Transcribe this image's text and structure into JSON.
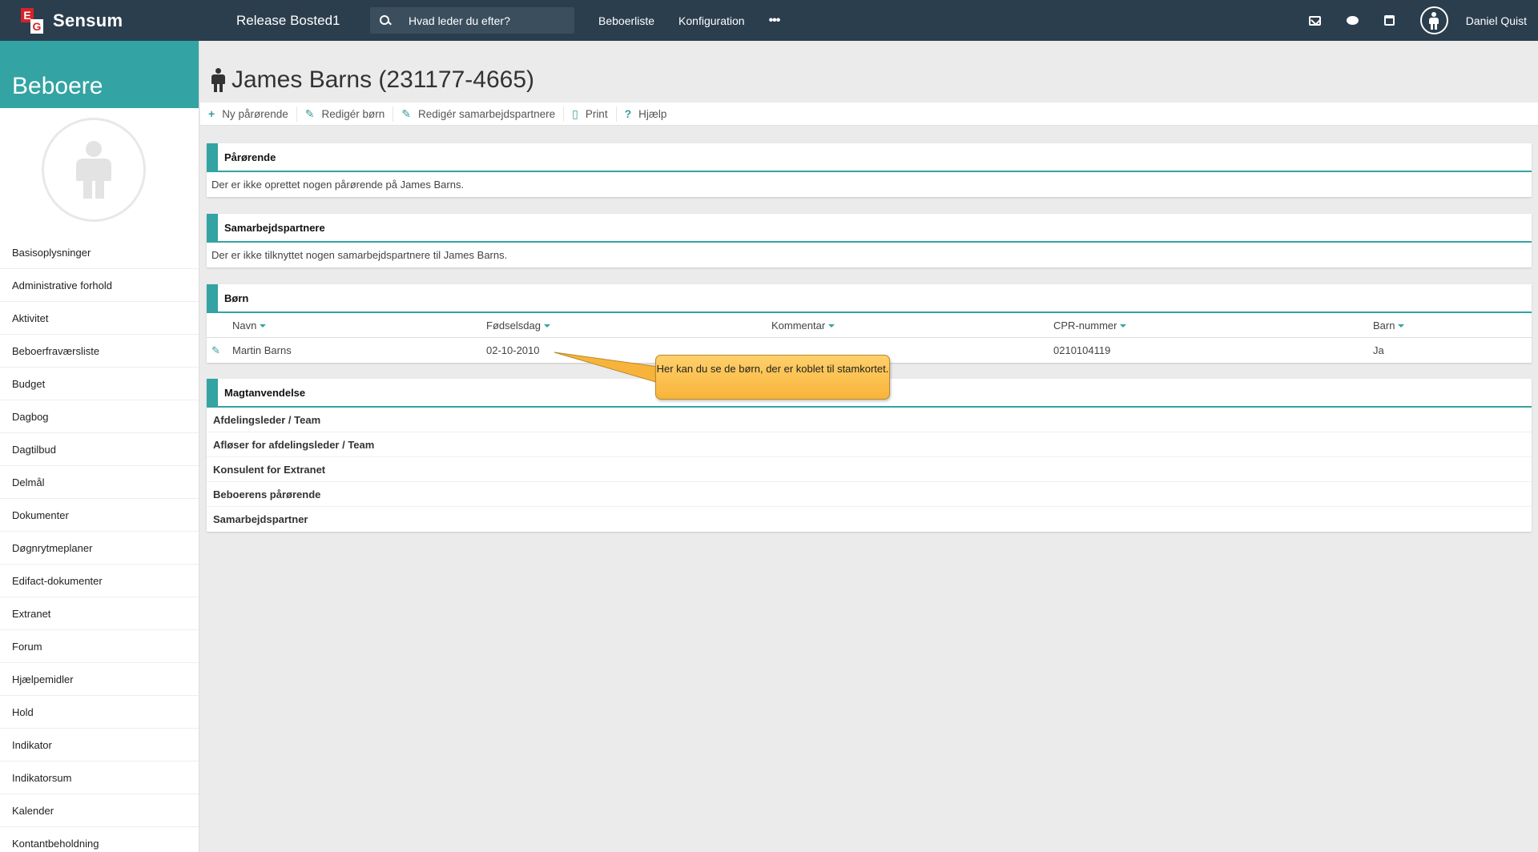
{
  "topbar": {
    "brand_e": "E",
    "brand_g": "G",
    "brand_name": "Sensum",
    "release": "Release Bosted1",
    "search_placeholder": "Hvad leder du efter?",
    "nav": [
      "Beboerliste",
      "Konfiguration"
    ],
    "more": "•••",
    "username": "Daniel Quist",
    "icons": [
      "mail-icon",
      "chat-icon",
      "calendar-icon",
      "user-avatar-icon"
    ]
  },
  "sidebar": {
    "title": "Beboere",
    "items": [
      "Basisoplysninger",
      "Administrative forhold",
      "Aktivitet",
      "Beboerfraværsliste",
      "Budget",
      "Dagbog",
      "Dagtilbud",
      "Delmål",
      "Dokumenter",
      "Døgnrytmeplaner",
      "Edifact-dokumenter",
      "Extranet",
      "Forum",
      "Hjælpemidler",
      "Hold",
      "Indikator",
      "Indikatorsum",
      "Kalender",
      "Kontantbeholdning"
    ]
  },
  "page": {
    "title": "James Barns (231177-4665)"
  },
  "toolbar": {
    "new_relative": "Ny pårørende",
    "edit_children": "Redigér børn",
    "edit_partners": "Redigér samarbejdspartnere",
    "print": "Print",
    "help": "Hjælp"
  },
  "relatives": {
    "title": "Pårørende",
    "empty": "Der er ikke oprettet nogen pårørende på James Barns."
  },
  "partners": {
    "title": "Samarbejdspartnere",
    "empty": "Der er ikke tilknyttet nogen samarbejdspartnere til James Barns."
  },
  "children": {
    "title": "Børn",
    "columns": [
      "Navn",
      "Fødselsdag",
      "Kommentar",
      "CPR-nummer",
      "Barn"
    ],
    "rows": [
      {
        "name": "Martin Barns",
        "birthday": "02-10-2010",
        "comment": "",
        "cpr": "0210104119",
        "child": "Ja"
      }
    ]
  },
  "callout": {
    "text": "Her kan du se de børn, der er koblet til stamkortet."
  },
  "force": {
    "title": "Magtanvendelse",
    "rows": [
      "Afdelingsleder / Team",
      "Afløser for afdelingsleder / Team",
      "Konsulent for Extranet",
      "Beboerens pårørende",
      "Samarbejdspartner"
    ]
  },
  "colors": {
    "topbar": "#2b3e4e",
    "accent": "#33a3a3",
    "callout": "#f8b43a"
  }
}
